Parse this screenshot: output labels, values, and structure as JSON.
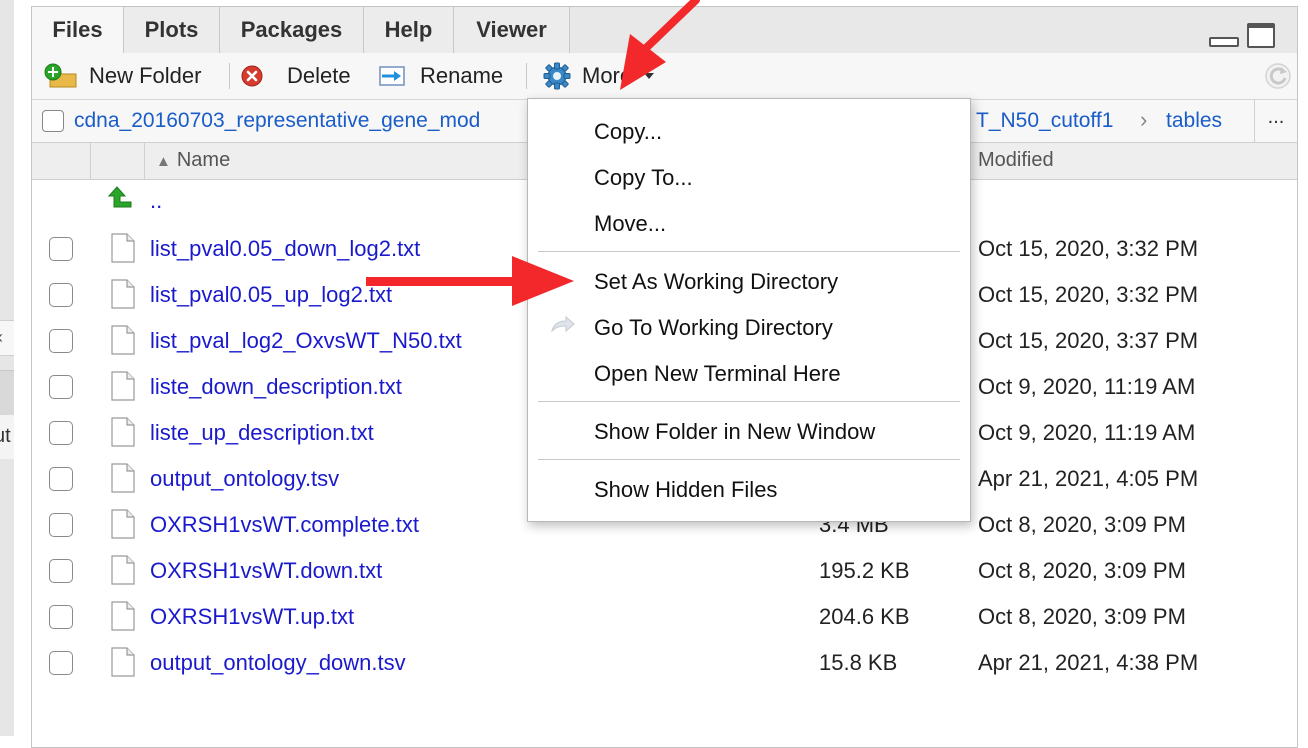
{
  "tabs": [
    {
      "label": "Files",
      "active": true
    },
    {
      "label": "Plots"
    },
    {
      "label": "Packages"
    },
    {
      "label": "Help"
    },
    {
      "label": "Viewer"
    }
  ],
  "toolbar": {
    "new_folder": "New Folder",
    "delete": "Delete",
    "rename": "Rename",
    "more": "More"
  },
  "path": {
    "first": "cdna_20160703_representative_gene_mod",
    "second": "T_N50_cutoff1",
    "last": "tables",
    "overflow": "..."
  },
  "columns": {
    "name": "Name",
    "modified": "Modified"
  },
  "parent_link": "..",
  "files": [
    {
      "name": "list_pval0.05_down_log2.txt",
      "size": "",
      "modified": "Oct 15, 2020, 3:32 PM"
    },
    {
      "name": "list_pval0.05_up_log2.txt",
      "size": "",
      "modified": "Oct 15, 2020, 3:32 PM"
    },
    {
      "name": "list_pval_log2_OxvsWT_N50.txt",
      "size": "",
      "modified": "Oct 15, 2020, 3:37 PM"
    },
    {
      "name": "liste_down_description.txt",
      "size": "",
      "modified": "Oct 9, 2020, 11:19 AM"
    },
    {
      "name": "liste_up_description.txt",
      "size": "",
      "modified": "Oct 9, 2020, 11:19 AM"
    },
    {
      "name": "output_ontology.tsv",
      "size": "",
      "modified": "Apr 21, 2021, 4:05 PM"
    },
    {
      "name": "OXRSH1vsWT.complete.txt",
      "size": "3.4 MB",
      "modified": "Oct 8, 2020, 3:09 PM"
    },
    {
      "name": "OXRSH1vsWT.down.txt",
      "size": "195.2 KB",
      "modified": "Oct 8, 2020, 3:09 PM"
    },
    {
      "name": "OXRSH1vsWT.up.txt",
      "size": "204.6 KB",
      "modified": "Oct 8, 2020, 3:09 PM"
    },
    {
      "name": "output_ontology_down.tsv",
      "size": "15.8 KB",
      "modified": "Apr 21, 2021, 4:38 PM"
    }
  ],
  "more_menu": {
    "copy": "Copy...",
    "copy_to": "Copy To...",
    "move": "Move...",
    "set_wd": "Set As Working Directory",
    "go_wd": "Go To Working Directory",
    "terminal": "Open New Terminal Here",
    "new_window": "Show Folder in New Window",
    "hidden": "Show Hidden Files"
  },
  "left_edge": {
    "glyph_a": "‹",
    "glyph_b": "ut"
  },
  "colors": {
    "link": "#1a1acc",
    "arrow": "#f2282a",
    "accent_blue": "#1a5cc8"
  },
  "icons": [
    "new-folder-icon",
    "delete-icon",
    "rename-icon",
    "gear-icon",
    "refresh-icon",
    "up-arrow-icon",
    "file-icon",
    "go-to-directory-icon"
  ]
}
